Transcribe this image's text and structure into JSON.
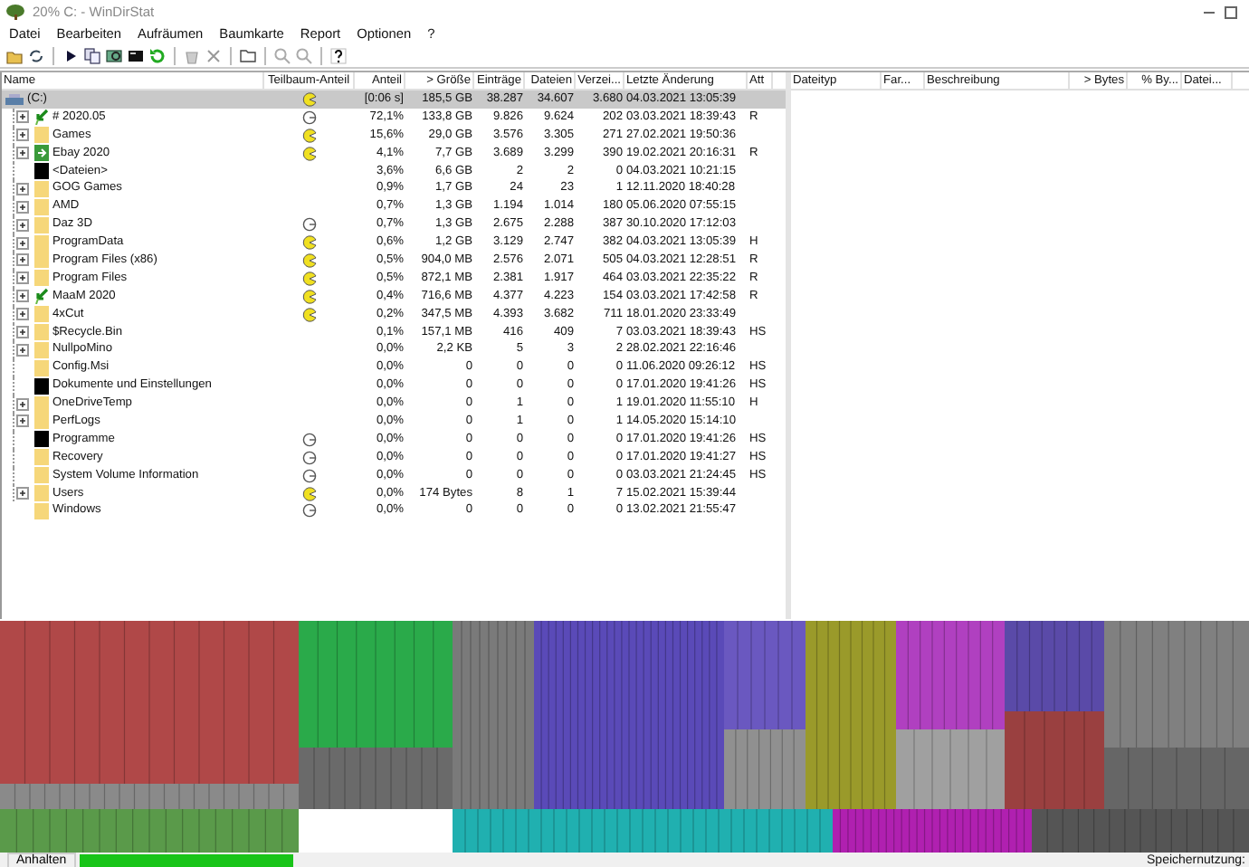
{
  "window": {
    "title": "20% C: - WinDirStat"
  },
  "menu": [
    "Datei",
    "Bearbeiten",
    "Aufräumen",
    "Baumkarte",
    "Report",
    "Optionen",
    "?"
  ],
  "left_table": {
    "columns": [
      "Name",
      "Teilbaum-Anteil",
      "Anteil",
      "> Größe",
      "Einträge",
      "Dateien",
      "Verzei...",
      "Letzte Änderung",
      "Att"
    ],
    "rows": [
      {
        "name": "(C:)",
        "kind": "drive",
        "expandable": false,
        "pie_filled": true,
        "share": "[0:06 s]",
        "size": "185,5 GB",
        "entries": "38.287",
        "files": "34.607",
        "dirs": "3.680",
        "modified": "04.03.2021 13:05:39",
        "attr": "",
        "selected": true
      },
      {
        "name": "# 2020.05",
        "kind": "shortcut",
        "expandable": true,
        "pie_filled": false,
        "share": "72,1%",
        "size": "133,8 GB",
        "entries": "9.826",
        "files": "9.624",
        "dirs": "202",
        "modified": "03.03.2021 18:39:43",
        "attr": "R",
        "selected": false
      },
      {
        "name": "Games",
        "kind": "folder",
        "expandable": true,
        "pie_filled": true,
        "share": "15,6%",
        "size": "29,0 GB",
        "entries": "3.576",
        "files": "3.305",
        "dirs": "271",
        "modified": "27.02.2021 19:50:36",
        "attr": "",
        "selected": false
      },
      {
        "name": "Ebay 2020",
        "kind": "app",
        "expandable": true,
        "pie_filled": true,
        "share": "4,1%",
        "size": "7,7 GB",
        "entries": "3.689",
        "files": "3.299",
        "dirs": "390",
        "modified": "19.02.2021 20:16:31",
        "attr": "R",
        "selected": false
      },
      {
        "name": "<Dateien>",
        "kind": "files",
        "expandable": false,
        "share": "3,6%",
        "size": "6,6 GB",
        "entries": "2",
        "files": "2",
        "dirs": "0",
        "modified": "04.03.2021 10:21:15",
        "attr": "",
        "selected": false
      },
      {
        "name": "GOG Games",
        "kind": "folder",
        "expandable": true,
        "share": "0,9%",
        "size": "1,7 GB",
        "entries": "24",
        "files": "23",
        "dirs": "1",
        "modified": "12.11.2020 18:40:28",
        "attr": "",
        "selected": false
      },
      {
        "name": "AMD",
        "kind": "folder",
        "expandable": true,
        "share": "0,7%",
        "size": "1,3 GB",
        "entries": "1.194",
        "files": "1.014",
        "dirs": "180",
        "modified": "05.06.2020 07:55:15",
        "attr": "",
        "selected": false
      },
      {
        "name": "Daz 3D",
        "kind": "folder",
        "expandable": true,
        "pie_filled": false,
        "share": "0,7%",
        "size": "1,3 GB",
        "entries": "2.675",
        "files": "2.288",
        "dirs": "387",
        "modified": "30.10.2020 17:12:03",
        "attr": "",
        "selected": false
      },
      {
        "name": "ProgramData",
        "kind": "folder",
        "expandable": true,
        "pie_filled": true,
        "share": "0,6%",
        "size": "1,2 GB",
        "entries": "3.129",
        "files": "2.747",
        "dirs": "382",
        "modified": "04.03.2021 13:05:39",
        "attr": "H",
        "selected": false
      },
      {
        "name": "Program Files (x86)",
        "kind": "folder",
        "expandable": true,
        "pie_filled": true,
        "share": "0,5%",
        "size": "904,0 MB",
        "entries": "2.576",
        "files": "2.071",
        "dirs": "505",
        "modified": "04.03.2021 12:28:51",
        "attr": "R",
        "selected": false
      },
      {
        "name": "Program Files",
        "kind": "folder",
        "expandable": true,
        "pie_filled": true,
        "share": "0,5%",
        "size": "872,1 MB",
        "entries": "2.381",
        "files": "1.917",
        "dirs": "464",
        "modified": "03.03.2021 22:35:22",
        "attr": "R",
        "selected": false
      },
      {
        "name": "MaaM 2020",
        "kind": "shortcut",
        "expandable": true,
        "pie_filled": true,
        "share": "0,4%",
        "size": "716,6 MB",
        "entries": "4.377",
        "files": "4.223",
        "dirs": "154",
        "modified": "03.03.2021 17:42:58",
        "attr": "R",
        "selected": false
      },
      {
        "name": "4xCut",
        "kind": "folder",
        "expandable": true,
        "pie_filled": true,
        "share": "0,2%",
        "size": "347,5 MB",
        "entries": "4.393",
        "files": "3.682",
        "dirs": "711",
        "modified": "18.01.2020 23:33:49",
        "attr": "",
        "selected": false
      },
      {
        "name": "$Recycle.Bin",
        "kind": "folder",
        "expandable": true,
        "share": "0,1%",
        "size": "157,1 MB",
        "entries": "416",
        "files": "409",
        "dirs": "7",
        "modified": "03.03.2021 18:39:43",
        "attr": "HS",
        "selected": false
      },
      {
        "name": "NullpoMino",
        "kind": "folder",
        "expandable": true,
        "share": "0,0%",
        "size": "2,2 KB",
        "entries": "5",
        "files": "3",
        "dirs": "2",
        "modified": "28.02.2021 22:16:46",
        "attr": "",
        "selected": false
      },
      {
        "name": "Config.Msi",
        "kind": "folder",
        "expandable": false,
        "share": "0,0%",
        "size": "0",
        "entries": "0",
        "files": "0",
        "dirs": "0",
        "modified": "11.06.2020 09:26:12",
        "attr": "HS",
        "selected": false
      },
      {
        "name": "Dokumente und Einstellungen",
        "kind": "files",
        "expandable": false,
        "share": "0,0%",
        "size": "0",
        "entries": "0",
        "files": "0",
        "dirs": "0",
        "modified": "17.01.2020 19:41:26",
        "attr": "HS",
        "selected": false
      },
      {
        "name": "OneDriveTemp",
        "kind": "folder",
        "expandable": true,
        "share": "0,0%",
        "size": "0",
        "entries": "1",
        "files": "0",
        "dirs": "1",
        "modified": "19.01.2020 11:55:10",
        "attr": "H",
        "selected": false
      },
      {
        "name": "PerfLogs",
        "kind": "folder",
        "expandable": true,
        "share": "0,0%",
        "size": "0",
        "entries": "1",
        "files": "0",
        "dirs": "1",
        "modified": "14.05.2020 15:14:10",
        "attr": "",
        "selected": false
      },
      {
        "name": "Programme",
        "kind": "files",
        "expandable": false,
        "pie_filled": false,
        "share": "0,0%",
        "size": "0",
        "entries": "0",
        "files": "0",
        "dirs": "0",
        "modified": "17.01.2020 19:41:26",
        "attr": "HS",
        "selected": false
      },
      {
        "name": "Recovery",
        "kind": "folder",
        "expandable": false,
        "pie_filled": false,
        "share": "0,0%",
        "size": "0",
        "entries": "0",
        "files": "0",
        "dirs": "0",
        "modified": "17.01.2020 19:41:27",
        "attr": "HS",
        "selected": false
      },
      {
        "name": "System Volume Information",
        "kind": "folder",
        "expandable": false,
        "pie_filled": false,
        "share": "0,0%",
        "size": "0",
        "entries": "0",
        "files": "0",
        "dirs": "0",
        "modified": "03.03.2021 21:24:45",
        "attr": "HS",
        "selected": false
      },
      {
        "name": "Users",
        "kind": "folder",
        "expandable": true,
        "pie_filled": true,
        "share": "0,0%",
        "size": "174 Bytes",
        "entries": "8",
        "files": "1",
        "dirs": "7",
        "modified": "15.02.2021 15:39:44",
        "attr": "",
        "selected": false
      },
      {
        "name": "Windows",
        "kind": "folder",
        "expandable": false,
        "pie_filled": false,
        "share": "0,0%",
        "size": "0",
        "entries": "0",
        "files": "0",
        "dirs": "0",
        "modified": "13.02.2021 21:55:47",
        "attr": "",
        "selected": false
      }
    ]
  },
  "right_table": {
    "columns": [
      "Dateityp",
      "Far...",
      "Beschreibung",
      "> Bytes",
      "% By...",
      "Datei..."
    ]
  },
  "status_bar": {
    "button": "Anhalten",
    "progress": {
      "level": 0.2
    },
    "label": "Speichernutzung:"
  }
}
